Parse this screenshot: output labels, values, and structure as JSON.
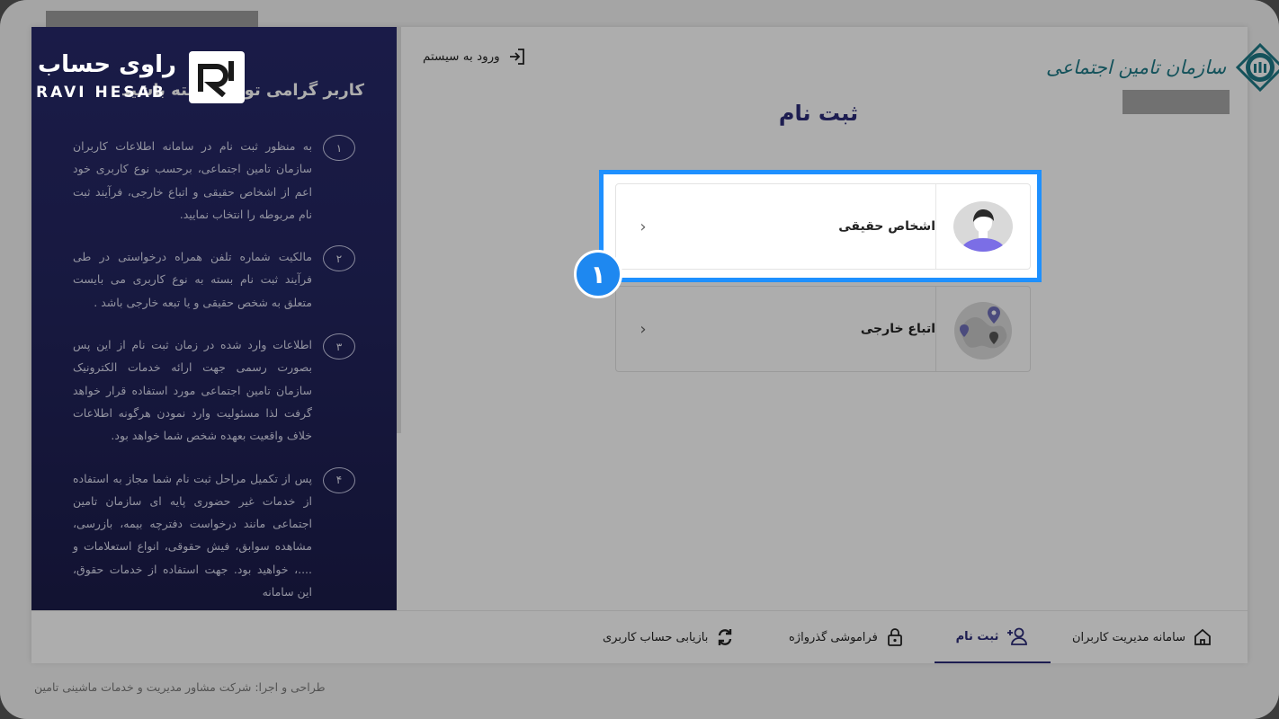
{
  "brand": {
    "watermark_fa": "راوی حساب",
    "watermark_en": "RAVI HESAB",
    "org_name": "سازمان تامین اجتماعی"
  },
  "header": {
    "login_label": "ورود به سیستم",
    "page_title": "ثبت نام"
  },
  "sidebar": {
    "title": "کاربر گرامی توجه داشته باشید",
    "steps": [
      {
        "num": "۱",
        "text": "به منظور ثبت نام در سامانه اطلاعات کاربران سازمان تامین اجتماعی، برحسب نوع کاربری خود اعم از اشخاص حقیقی و اتباع خارجی، فرآیند ثبت نام مربوطه را انتخاب نمایید."
      },
      {
        "num": "۲",
        "text": "مالکیت شماره تلفن همراه درخواستی در طی فرآیند ثبت نام بسته به نوع کاربری می بایست متعلق به شخص حقیقی و یا تبعه خارجی باشد ."
      },
      {
        "num": "۳",
        "text": "اطلاعات وارد شده در زمان ثبت نام از این پس بصورت رسمی جهت ارائه خدمات الکترونیک سازمان تامین اجتماعی مورد استفاده قرار خواهد گرفت لذا مسئولیت وارد نمودن هرگونه اطلاعات خلاف واقعیت بعهده شخص شما خواهد بود."
      },
      {
        "num": "۴",
        "text": "پس از تکمیل مراحل ثبت نام شما مجاز به استفاده از خدمات غیر حضوری پایه ای سازمان تامین اجتماعی مانند درخواست دفترچه بیمه، بازرسی، مشاهده سوابق، فیش حقوقی، انواع استعلامات و ....، خواهید بود. جهت استفاده از خدمات حقوق، این سامانه"
      }
    ]
  },
  "options": {
    "real_person": "اشخاص حقیقی",
    "foreign_national": "اتباع خارجی"
  },
  "annotation": {
    "step_badge": "۱"
  },
  "tabs": {
    "management": "سامانه مدیریت کاربران",
    "register": "ثبت نام",
    "forgot_password": "فراموشی گذرواژه",
    "recover_account": "بازیابی حساب کاربری"
  },
  "footer": {
    "credit": "طراحی و اجرا: شرکت مشاور مدیریت و خدمات ماشینی تامین"
  },
  "colors": {
    "primary": "#2b2b78",
    "highlight": "#1e90ff",
    "org_teal": "#1e7a86"
  }
}
